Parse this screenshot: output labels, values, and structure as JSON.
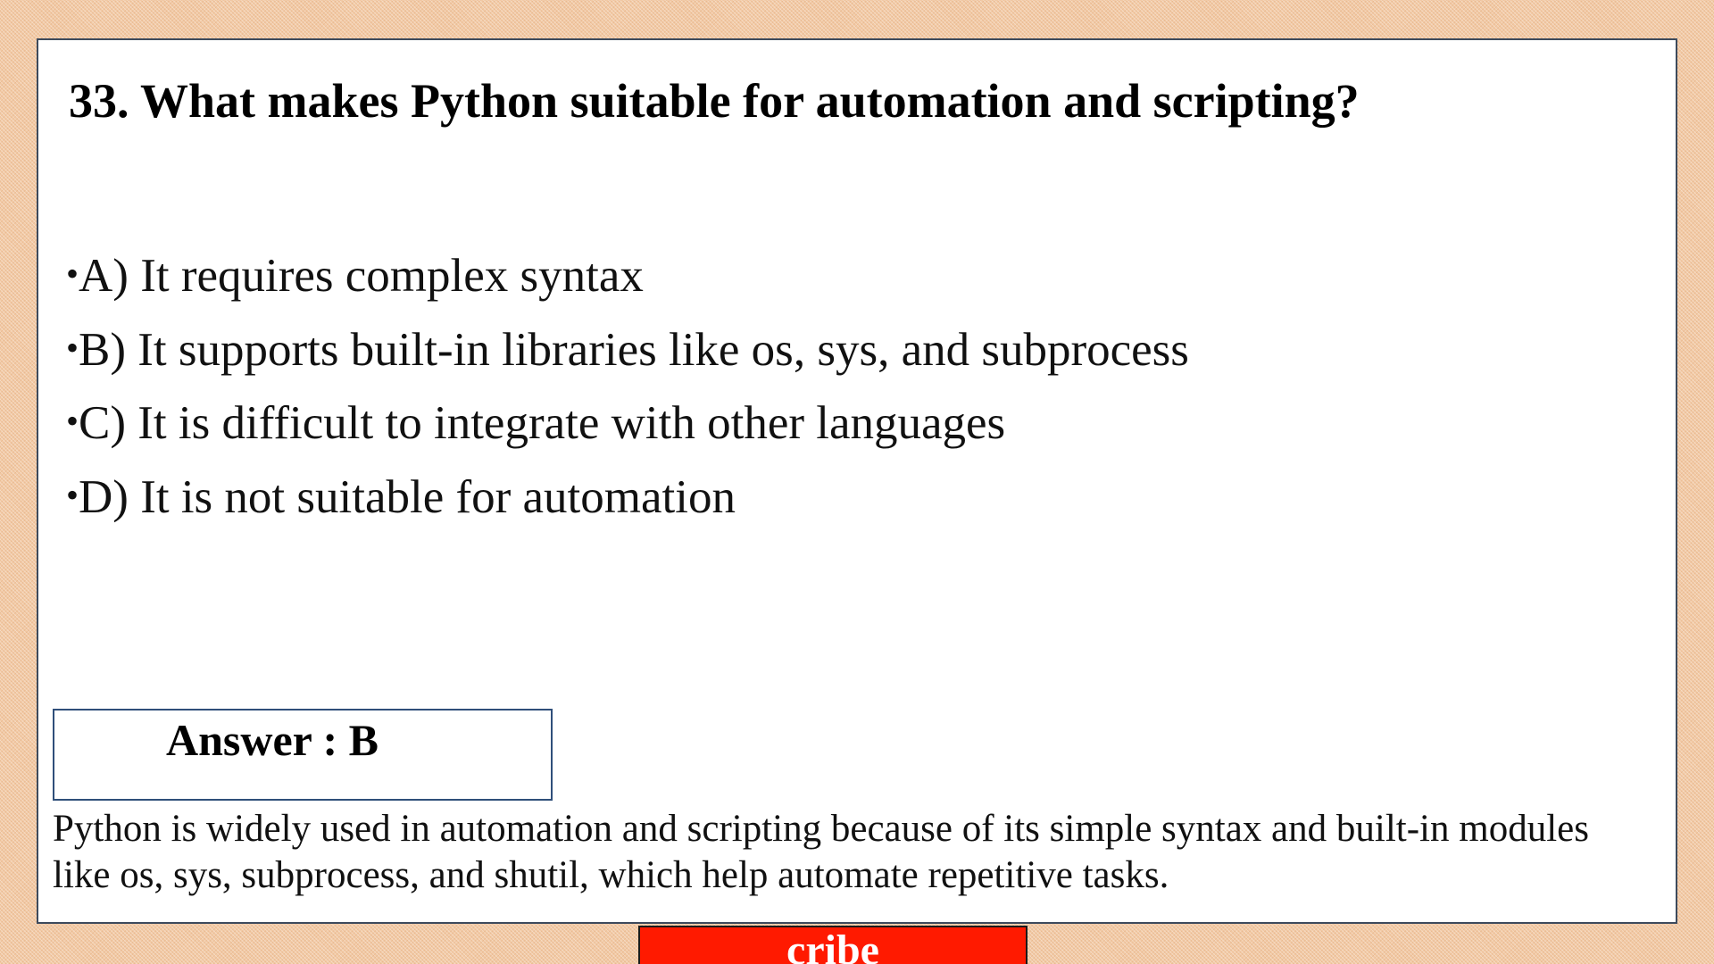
{
  "question": {
    "title": "33. What makes Python suitable for automation and scripting?"
  },
  "options": [
    {
      "bullet": "•",
      "text": "A) It requires complex syntax"
    },
    {
      "bullet": "•",
      "text": "B) It supports built-in libraries like os, sys, and subprocess"
    },
    {
      "bullet": "•",
      "text": "C) It is difficult to integrate with other languages"
    },
    {
      "bullet": "•",
      "text": "D) It is not suitable for automation"
    }
  ],
  "answer": {
    "label": "Answer : B"
  },
  "explanation": {
    "text": "Python is widely used in automation and scripting because of its simple syntax and built-in modules like os, sys, subprocess, and shutil, which help automate repetitive tasks."
  },
  "banner": {
    "label": "cribe",
    "color": "#ff1a00"
  },
  "colors": {
    "background": "#f2c9a4",
    "slide": "#ffffff",
    "answer_border": "#2f4f7a"
  }
}
